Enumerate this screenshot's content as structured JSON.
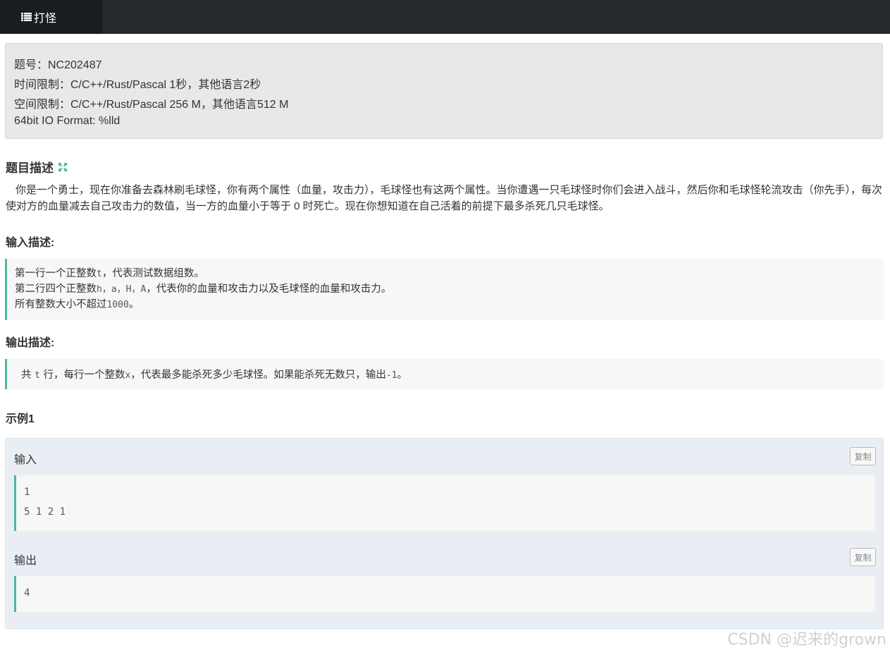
{
  "nav": {
    "tab_label": "打怪",
    "tab_icon": "list-icon"
  },
  "info": {
    "problem_id": "题号：NC202487",
    "time_limit": "时间限制：C/C++/Rust/Pascal 1秒，其他语言2秒",
    "memory_limit": "空间限制：C/C++/Rust/Pascal 256 M，其他语言512 M",
    "io_format": "64bit IO Format: %lld"
  },
  "description": {
    "title": "题目描述",
    "expand_icon": "expand-icon",
    "text": "你是一个勇士，现在你准备去森林刷毛球怪，你有两个属性（血量，攻击力），毛球怪也有这两个属性。当你遭遇一只毛球怪时你们会进入战斗，然后你和毛球怪轮流攻击（你先手），每次使对方的血量减去自己攻击力的数值，当一方的血量小于等于 0 时死亡。现在你想知道在自己活着的前提下最多杀死几只毛球怪。"
  },
  "input_desc": {
    "title": "输入描述:",
    "line1_a": "第一行一个正整数",
    "line1_var": "t",
    "line1_b": "，代表测试数据组数。",
    "line2_a": "第二行四个正整数",
    "line2_var": "h，a，H，A",
    "line2_b": "，代表你的血量和攻击力以及毛球怪的血量和攻击力。",
    "line3_a": "所有整数大小不超过",
    "line3_var": "1000",
    "line3_b": "。"
  },
  "output_desc": {
    "title": "输出描述:",
    "text_a": "共 ",
    "var_t": "t",
    "text_b": " 行，每行一个整数",
    "var_x": "x",
    "text_c": "，代表最多能杀死多少毛球怪。如果能杀死无数只，输出",
    "var_neg": "-1",
    "text_d": "。"
  },
  "example": {
    "title": "示例1",
    "input_label": "输入",
    "output_label": "输出",
    "copy_label": "复制",
    "input_lines": [
      "1",
      "5 1 2 1"
    ],
    "output_lines": [
      "4"
    ]
  },
  "watermark": "CSDN @迟来的grown",
  "colors": {
    "topbar": "#25292c",
    "accent": "#4db6a4",
    "info_bg": "#e8e8e8",
    "example_bg": "#e9eef5"
  }
}
